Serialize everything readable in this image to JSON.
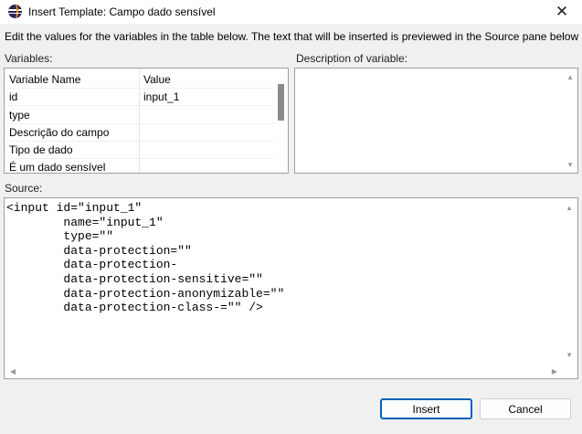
{
  "window": {
    "title": "Insert Template: Campo dado sensível",
    "close_glyph": "✕"
  },
  "description": "Edit the values for the variables in the table below.  The text that will be inserted is previewed in the Source pane below",
  "labels": {
    "variables": "Variables:",
    "description_of_variable": "Description of variable:",
    "source": "Source:"
  },
  "variables_table": {
    "headers": [
      "Variable Name",
      "Value"
    ],
    "rows": [
      {
        "name": "id",
        "value": "input_1"
      },
      {
        "name": "type",
        "value": ""
      },
      {
        "name": "Descrição do campo",
        "value": ""
      },
      {
        "name": "Tipo de dado",
        "value": ""
      },
      {
        "name": "É um dado sensível",
        "value": ""
      }
    ]
  },
  "source_text": "<input id=\"input_1\"\n        name=\"input_1\"\n        type=\"\"\n        data-protection=\"\"\n        data-protection-\n        data-protection-sensitive=\"\"\n        data-protection-anonymizable=\"\"\n        data-protection-class-=\"\" />",
  "buttons": {
    "insert": "Insert",
    "cancel": "Cancel"
  },
  "icons": {
    "app": "eclipse-icon",
    "scroll_up": "▲",
    "scroll_down": "▼",
    "scroll_left": "◀",
    "scroll_right": "▶"
  },
  "colors": {
    "default_button_border": "#005fb8",
    "background": "#f0f0f0"
  }
}
